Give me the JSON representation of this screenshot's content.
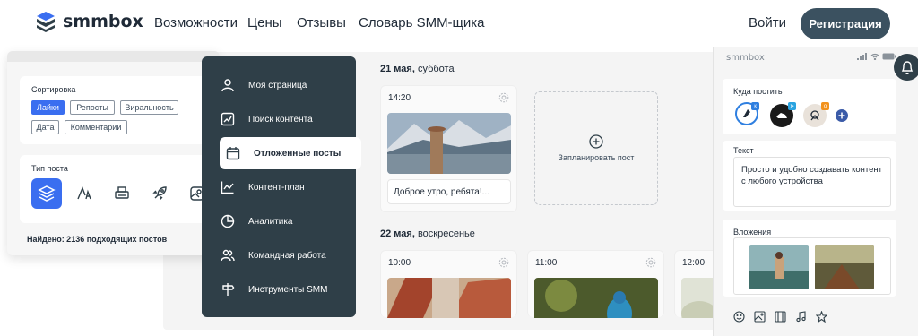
{
  "nav": {
    "brand": "smmbox",
    "links": [
      "Возможности",
      "Цены",
      "Отзывы",
      "Словарь SMM-щика"
    ],
    "login": "Войти",
    "register": "Регистрация"
  },
  "filters": {
    "sort_title": "Сортировка",
    "sort_tags": [
      "Лайки",
      "Репосты",
      "Виральность",
      "Дата",
      "Комментарии"
    ],
    "active_tag": "Лайки",
    "type_title": "Тип поста",
    "type_icons": [
      "layers-icon",
      "font-icon",
      "printer-icon",
      "rocket-icon",
      "image-icon"
    ],
    "found_text": "Найдено: 2136 подходящих постов"
  },
  "menu": {
    "items": [
      {
        "label": "Моя страница",
        "icon": "user-icon"
      },
      {
        "label": "Поиск контента",
        "icon": "search-chart-icon"
      },
      {
        "label": "Отложенные посты",
        "icon": "calendar-icon"
      },
      {
        "label": "Контент-план",
        "icon": "line-chart-icon"
      },
      {
        "label": "Аналитика",
        "icon": "pie-chart-icon"
      },
      {
        "label": "Командная работа",
        "icon": "team-icon"
      },
      {
        "label": "Инструменты SMM",
        "icon": "signpost-icon"
      }
    ],
    "active": "Отложенные посты"
  },
  "calendar": {
    "day1_bold": "21 мая,",
    "day1_rest": " суббота",
    "day2_bold": "22 мая,",
    "day2_rest": " воскресенье",
    "post1_time": "14:20",
    "post1_text": "Доброе утро, ребята!...",
    "schedule_label": "Запланировать пост",
    "post2_time": "10:00",
    "post3_time": "11:00",
    "post4_time": "12:00"
  },
  "phone": {
    "brand": "smmbox",
    "where_title": "Куда постить",
    "networks": [
      "vk",
      "telegram",
      "odnoklassniki"
    ],
    "text_title": "Текст",
    "text_value": "Просто и удобно создавать контент с любого устройства",
    "attach_title": "Вложения",
    "toolbar_icons": [
      "emoji-icon",
      "image-icon",
      "film-icon",
      "music-icon",
      "star-icon"
    ]
  },
  "colors": {
    "accent": "#3a6ef0",
    "dark": "#2f3f48",
    "register": "#3b5160"
  }
}
